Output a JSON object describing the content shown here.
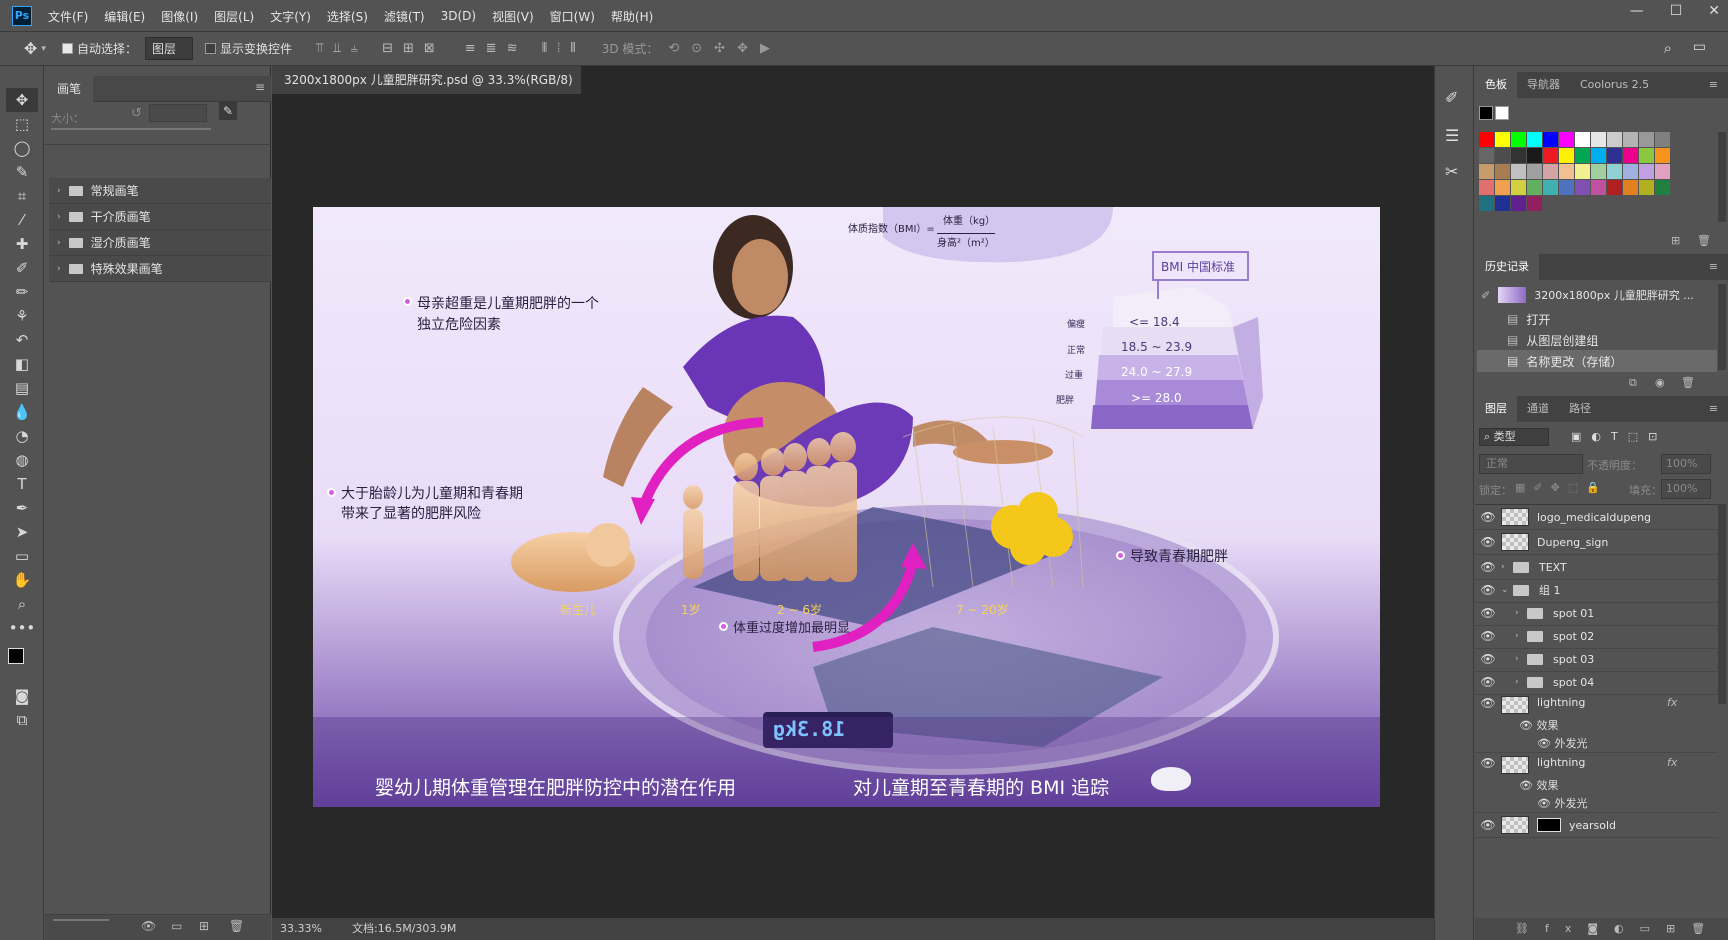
{
  "app": {
    "logo": "Ps"
  },
  "menu": [
    "文件(F)",
    "编辑(E)",
    "图像(I)",
    "图层(L)",
    "文字(Y)",
    "选择(S)",
    "滤镜(T)",
    "3D(D)",
    "视图(V)",
    "窗口(W)",
    "帮助(H)"
  ],
  "window_controls": {
    "minimize": "—",
    "restore": "☐",
    "close": "✕"
  },
  "options": {
    "auto_select_label": "自动选择：",
    "auto_select_value": "图层",
    "show_transform_label": "显示变换控件",
    "mode_3d_label": "3D 模式："
  },
  "brush_panel": {
    "tab": "画笔",
    "size_label": "大小：",
    "folders": [
      "常规画笔",
      "干介质画笔",
      "湿介质画笔",
      "特殊效果画笔"
    ]
  },
  "document": {
    "tab_title": "3200x1800px 儿童肥胖研究.psd @ 33.3%(RGB/8) *",
    "zoom": "33.33%",
    "doc_info": "文档:16.5M/303.9M"
  },
  "canvas": {
    "formula_label": "体质指数（BMI）=",
    "formula_num": "体重（kg）",
    "formula_den": "身高²（m²）",
    "bmi_standard": "BMI 中国标准",
    "bmi_rows": [
      {
        "cat": "偏瘦",
        "range": "<= 18.4"
      },
      {
        "cat": "正常",
        "range": "18.5 ~ 23.9"
      },
      {
        "cat": "过重",
        "range": "24.0 ~ 27.9"
      },
      {
        "cat": "肥胖",
        "range": ">= 28.0"
      }
    ],
    "note1_line1": "母亲超重是儿童期肥胖的一个",
    "note1_line2": "独立危险因素",
    "note2_line1": "大于胎龄儿为儿童期和青春期",
    "note2_line2": "带来了显著的肥胖风险",
    "note3": "导致青春期肥胖",
    "note4": "体重过度增加最明显",
    "age_labels": [
      "新生儿",
      "1岁",
      "2 ~ 6岁",
      "7 ~ 20岁"
    ],
    "scale_reading": "18.3kg",
    "caption_left": "婴幼儿期体重管理在肥胖防控中的潜在作用",
    "caption_right": "对儿童期至青春期的 BMI 追踪"
  },
  "right_panels": {
    "swatch_tabs": [
      "色板",
      "导航器",
      "Coolorus 2.5"
    ],
    "history_tab": "历史记录",
    "history_snapshot": "3200x1800px 儿童肥胖研究 ...",
    "history_items": [
      "打开",
      "从图层创建组",
      "名称更改（存储）"
    ],
    "layers_tabs": [
      "图层",
      "通道",
      "路径"
    ],
    "filter_label": "类型",
    "blend_mode": "正常",
    "opacity_label": "不透明度：",
    "opacity_value": "100%",
    "lock_label": "锁定：",
    "fill_label": "填充：",
    "fill_value": "100%",
    "effects_label": "效果",
    "outer_glow": "外发光",
    "layers": [
      "logo_medicaldupeng",
      "Dupeng_sign",
      "TEXT",
      "组 1",
      "spot 01",
      "spot 02",
      "spot 03",
      "spot 04",
      "lightning",
      "lightning",
      "yearsold"
    ]
  },
  "swatch_colors": [
    "#000000",
    "#ffffff",
    "#ff0000",
    "#ffff00",
    "#00ff00",
    "#00ffff",
    "#0000ff",
    "#ff00ff",
    "#ffffff",
    "#e6e6e6",
    "#cccccc",
    "#b3b3b3",
    "#999999",
    "#808080",
    "#666666",
    "#4d4d4d",
    "#333333",
    "#1a1a1a",
    "#ed1c24",
    "#fff200",
    "#00a651",
    "#00aeef",
    "#2e3192",
    "#ec008c",
    "#8dc63f",
    "#f7941d",
    "#c69c6d",
    "#a67c52"
  ]
}
